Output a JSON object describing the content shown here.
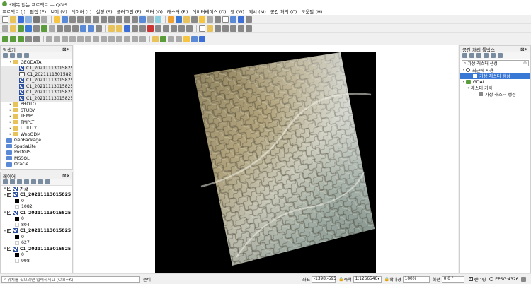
{
  "window": {
    "title": "*제목 없는 프로젝트 — QGIS"
  },
  "menubar": {
    "items": [
      "프로젝트 (J)",
      "편집 (E)",
      "보기 (V)",
      "레이어 (L)",
      "설정 (S)",
      "플러그인 (P)",
      "벡터 (O)",
      "래스터 (R)",
      "데이터베이스 (D)",
      "웹 (W)",
      "메시 (M)",
      "공간 처리 (C)",
      "도움말 (H)"
    ]
  },
  "browser": {
    "title": "탐색기",
    "items": [
      {
        "label": "GEODATA",
        "type": "folder",
        "indent": 1,
        "arrow": "▾"
      },
      {
        "label": "C1_20211113015825",
        "type": "raster",
        "indent": 2
      },
      {
        "label": "C1_20211113015825",
        "type": "vector",
        "indent": 2
      },
      {
        "label": "C1_20211113015825",
        "type": "raster",
        "indent": 2
      },
      {
        "label": "C1_20211113015825",
        "type": "raster",
        "indent": 2
      },
      {
        "label": "C1_20211113015825",
        "type": "raster",
        "indent": 2
      },
      {
        "label": "C1_20211113015825",
        "type": "raster",
        "indent": 2
      },
      {
        "label": "PHOTO",
        "type": "folder",
        "indent": 1,
        "arrow": "▸"
      },
      {
        "label": "STUDY",
        "type": "folder",
        "indent": 1,
        "arrow": "▸"
      },
      {
        "label": "TEMP",
        "type": "folder",
        "indent": 1,
        "arrow": "▸"
      },
      {
        "label": "TMPLT",
        "type": "folder",
        "indent": 1,
        "arrow": "▸"
      },
      {
        "label": "UTILITY",
        "type": "folder",
        "indent": 1,
        "arrow": "▸"
      },
      {
        "label": "WebODM",
        "type": "folder",
        "indent": 1,
        "arrow": "▸"
      },
      {
        "label": "GeoPackage",
        "type": "db",
        "indent": 0
      },
      {
        "label": "SpatiaLite",
        "type": "db",
        "indent": 0
      },
      {
        "label": "PostGIS",
        "type": "db",
        "indent": 0
      },
      {
        "label": "MSSQL",
        "type": "db",
        "indent": 0
      },
      {
        "label": "Oracle",
        "type": "db",
        "indent": 0
      }
    ]
  },
  "layers": {
    "title": "레이어",
    "group": "가상",
    "items": [
      {
        "name": "C1_20211113015825",
        "min": "0",
        "max": "1082"
      },
      {
        "name": "C1_20211113015825",
        "min": "0",
        "max": "804"
      },
      {
        "name": "C1_20211113015825",
        "min": "0",
        "max": "627"
      },
      {
        "name": "C1_20211113015825",
        "min": "0",
        "max": "998"
      }
    ]
  },
  "toolbox": {
    "title": "공간 처리 툴박스",
    "search_value": "가상 래스터 생성",
    "recent": "최근에 사용",
    "recent_item": "가상 래스터 생성",
    "provider": "GDAL",
    "category": "래스터 기타",
    "algorithm": "가상 래스터 생성"
  },
  "status": {
    "search_placeholder": "위치를 찾으려면 입력하세요 (Ctrl+K)",
    "ready": "준비",
    "coord_label": "좌표",
    "coord_value": "-1398,-595",
    "scale_label": "축척",
    "scale_value": "1:1266546",
    "magnifier_label": "확대경",
    "magnifier_value": "100%",
    "rotation_label": "회전",
    "rotation_value": "0.0 °",
    "render_label": "렌더링",
    "crs": "EPSG:4326"
  }
}
